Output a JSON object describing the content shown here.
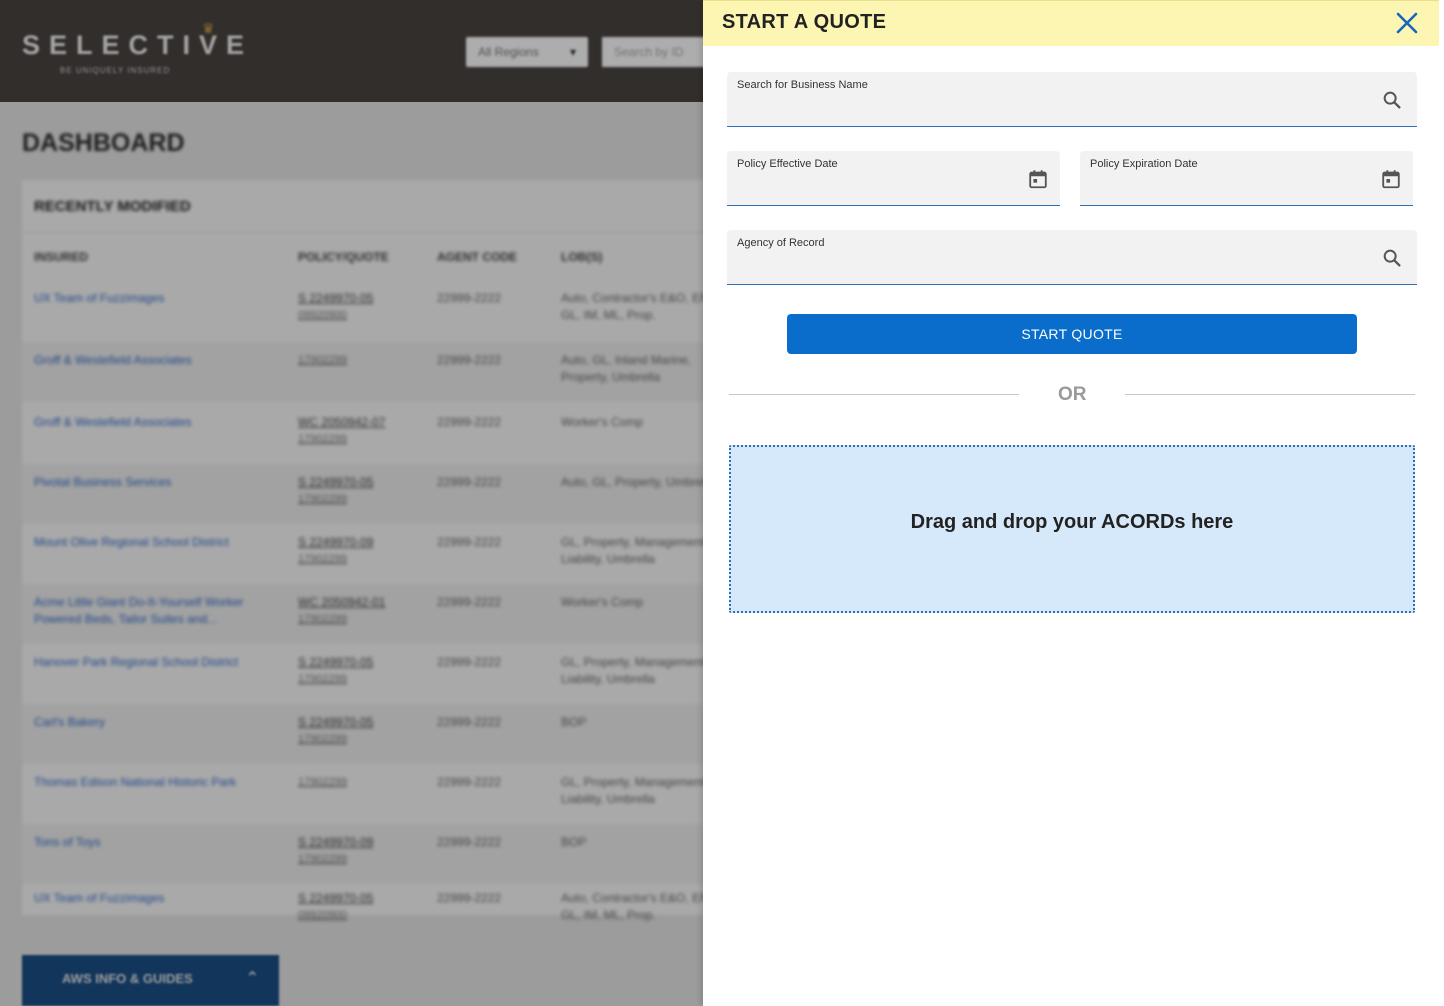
{
  "background": {
    "brand": "SELECTIVE",
    "brand_tagline": "BE UNIQUELY INSURED",
    "region_select": "All Regions",
    "search_placeholder": "Search by ID",
    "page_title": "DASHBOARD",
    "card_title": "RECENTLY MODIFIED",
    "columns": [
      "INSURED",
      "POLICY/QUOTE",
      "AGENT CODE",
      "LOB(S)"
    ],
    "rows": [
      {
        "insured": "UX Team of Fuzzimages",
        "policy": "S 2249970-05",
        "sub": "09920900",
        "agent": "22999-2222",
        "lob": "Auto, Contractor's E&O, EPLI, GL, IM, ML, Prop."
      },
      {
        "insured": "Groff & Westefield Associates",
        "policy": "",
        "sub": "17902299",
        "agent": "22999-2222",
        "lob": "Auto, GL, Inland Marine, Property, Umbrella"
      },
      {
        "insured": "Groff & Westefield Associates",
        "policy": "WC 2050942-07",
        "sub": "17902299",
        "agent": "22999-2222",
        "lob": "Worker's Comp"
      },
      {
        "insured": "Pivotal Business Services",
        "policy": "S 2249970-05",
        "sub": "17902299",
        "agent": "22999-2222",
        "lob": "Auto, GL, Property, Umbrella"
      },
      {
        "insured": "Mount Olive Regional School District",
        "policy": "S 2249970-09",
        "sub": "17902299",
        "agent": "22999-2222",
        "lob": "GL, Property, Management Liability, Umbrella"
      },
      {
        "insured": "Acme Little Giant Do-It-Yourself Worker Powered Beds, Tailor Suites and...",
        "policy": "WC 2050942-01",
        "sub": "17902299",
        "agent": "22999-2222",
        "lob": "Worker's Comp"
      },
      {
        "insured": "Hanover Park Regional School District",
        "policy": "S 2249970-05",
        "sub": "17902299",
        "agent": "22999-2222",
        "lob": "GL, Property, Management Liability, Umbrella"
      },
      {
        "insured": "Carl's Bakery",
        "policy": "S 2249970-05",
        "sub": "17902299",
        "agent": "22999-2222",
        "lob": "BOP"
      },
      {
        "insured": "Thomas Edison National Historic Park",
        "policy": "",
        "sub": "17902299",
        "agent": "22999-2222",
        "lob": "GL, Property, Management Liability, Umbrella"
      },
      {
        "insured": "Tons of Toys",
        "policy": "S 2249970-09",
        "sub": "17902299",
        "agent": "22999-2222",
        "lob": "BOP"
      },
      {
        "insured": "UX Team of Fuzzimages",
        "policy": "S 2249970-05",
        "sub": "09920900",
        "agent": "22999-2222",
        "lob": "Auto, Contractor's E&O, EPLI, GL, IM, ML, Prop."
      }
    ],
    "bottom_tab": "AWS INFO & GUIDES"
  },
  "panel": {
    "title": "START A QUOTE",
    "fields": {
      "business_name": {
        "label": "Search for Business Name",
        "value": ""
      },
      "effective_date": {
        "label": "Policy Effective Date",
        "value": ""
      },
      "expiration_date": {
        "label": "Policy Expiration Date",
        "value": ""
      },
      "agency": {
        "label": "Agency of Record",
        "value": ""
      }
    },
    "start_button": "START QUOTE",
    "or_text": "OR",
    "dropzone_text": "Drag and drop your ACORDs here"
  },
  "colors": {
    "header_bg": "#fdf6b3",
    "primary": "#0a6dcc",
    "field_underline": "#2e6fbd",
    "dropzone_bg": "#d6e9fa",
    "topbar": "#4b4442"
  },
  "icons": {
    "close": "close-icon",
    "search": "search-icon",
    "calendar": "calendar-icon"
  }
}
